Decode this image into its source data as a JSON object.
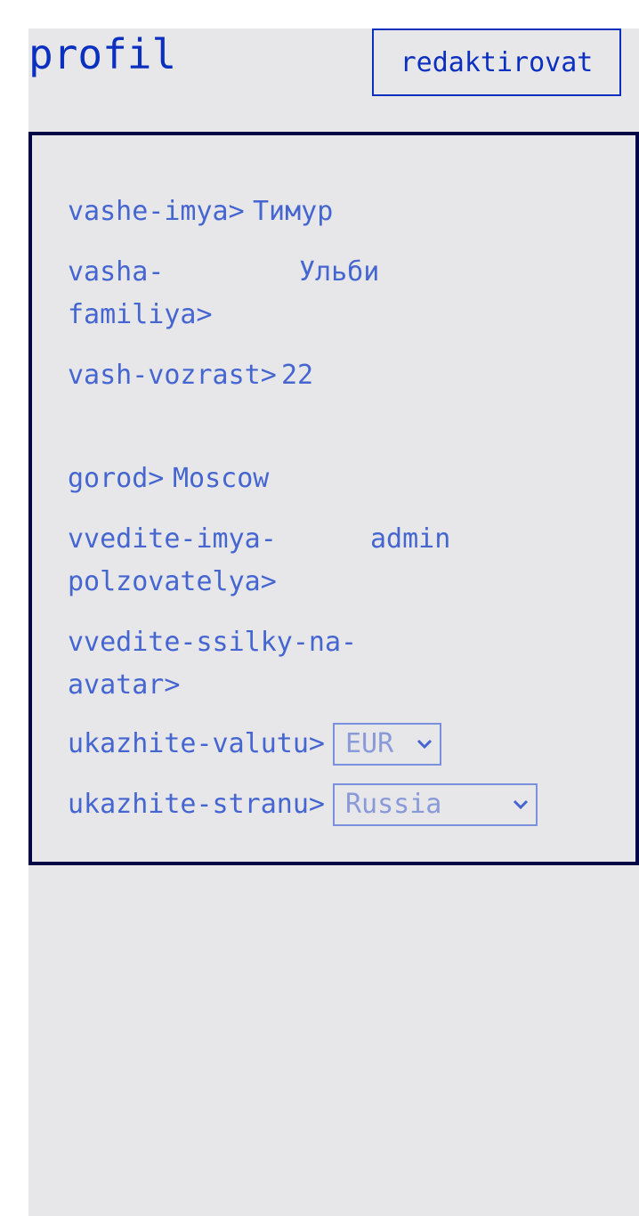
{
  "header": {
    "title": "profil",
    "edit_label": "redaktirovat"
  },
  "profile": {
    "name_label": "vashe-imya>",
    "name_value": "Тимур",
    "surname_label": "vasha-familiya>",
    "surname_value": "Ульби",
    "age_label": "vash-vozrast>",
    "age_value": "22",
    "city_label": "gorod>",
    "city_value": "Moscow",
    "username_label": "vvedite-imya-polzovatelya>",
    "username_value": "admin",
    "avatar_label": "vvedite-ssilky-na-avatar>",
    "avatar_value": "",
    "currency_label": "ukazhite-valutu>",
    "currency_value": "EUR",
    "country_label": "ukazhite-stranu>",
    "country_value": "Russia"
  },
  "icons": {
    "currency_chevron": "chevron-down-icon",
    "country_chevron": "chevron-down-icon"
  },
  "colors": {
    "primary": "#0b2fbf",
    "text": "#4566d0",
    "border_dark": "#020646",
    "page_bg": "#e7e7ea"
  }
}
